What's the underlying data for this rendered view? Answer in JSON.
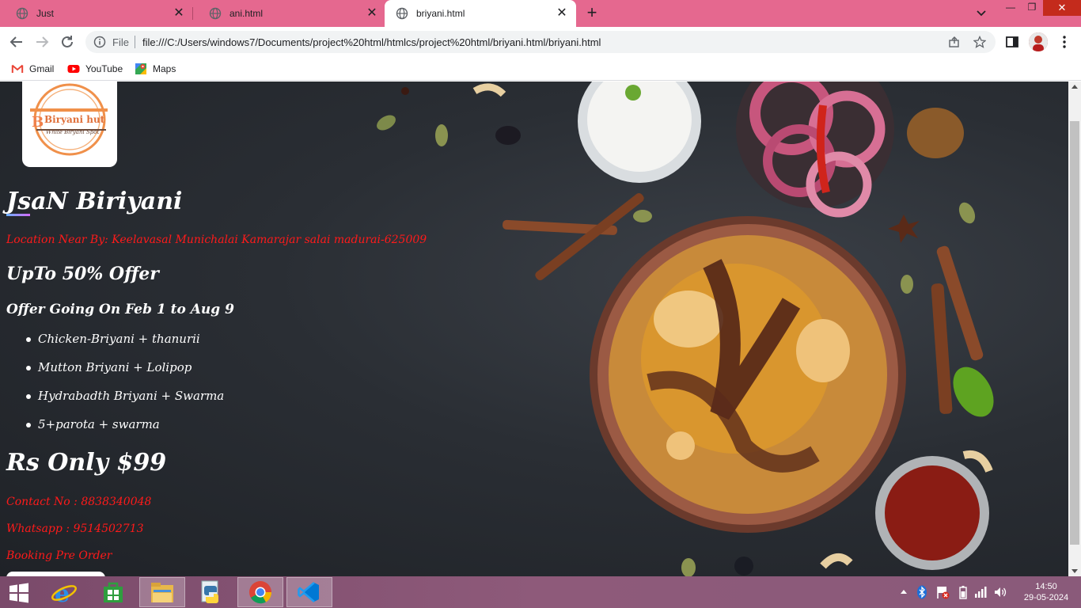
{
  "browser": {
    "tabs": [
      {
        "label": "Just",
        "active": false
      },
      {
        "label": "ani.html",
        "active": false
      },
      {
        "label": "briyani.html",
        "active": true
      }
    ],
    "omnibox": {
      "scheme_label": "File",
      "url": "file:///C:/Users/windows7/Documents/project%20html/htmlcs/project%20html/briyani.html/briyani.html"
    },
    "bookmarks": [
      {
        "label": "Gmail"
      },
      {
        "label": "YouTube"
      },
      {
        "label": "Maps"
      }
    ],
    "window_controls": {
      "minimize": "—",
      "maximize": "❐",
      "close": "✕"
    },
    "tab_close_glyph": "✕",
    "new_tab_glyph": "+"
  },
  "page": {
    "logo": {
      "line1": "Biryani hut",
      "line2": "White Biryani Spot"
    },
    "brand_title": "JsaN Biriyani",
    "location": "Location Near By: Keelavasal Munichalai Kamarajar salai madurai-625009",
    "offer_title": "UpTo 50% Offer",
    "offer_dates": "Offer Going On Feb 1 to Aug 9",
    "menu": [
      "Chicken-Briyani + thanurii",
      "Mutton Briyani + Lolipop",
      "Hydrabadth Briyani + Swarma",
      "5+parota + swarma"
    ],
    "price": "Rs Only $99",
    "contact": "Contact No : 8838340048",
    "whatsapp": "Whatsapp : 9514502713",
    "booking": "Booking Pre Order",
    "colors": {
      "accent_red": "#ff1a1a",
      "tab_strip": "#e5688f"
    }
  },
  "taskbar": {
    "apps": [
      {
        "icon": "internet-explorer-icon",
        "open": false
      },
      {
        "icon": "store-icon",
        "open": false
      },
      {
        "icon": "file-explorer-icon",
        "open": true
      },
      {
        "icon": "python-icon",
        "open": false
      },
      {
        "icon": "chrome-icon",
        "open": true
      },
      {
        "icon": "vscode-icon",
        "open": true
      }
    ],
    "time": "14:50",
    "date": "29-05-2024"
  }
}
